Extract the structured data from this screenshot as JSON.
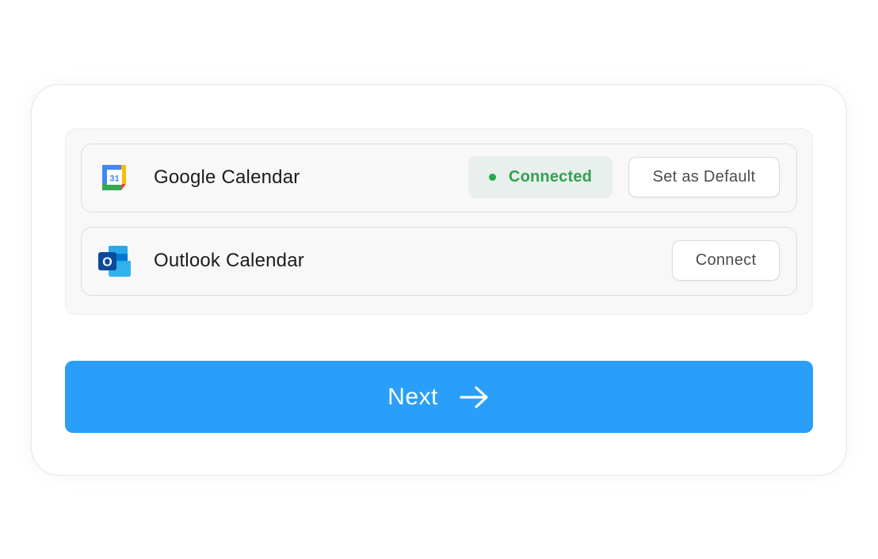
{
  "integrations": [
    {
      "name": "Google Calendar",
      "icon": "google-calendar-icon",
      "icon_date": "31",
      "status": "Connected",
      "action_label": "Set as Default"
    },
    {
      "name": "Outlook Calendar",
      "icon": "outlook-icon",
      "icon_letter": "O",
      "action_label": "Connect"
    }
  ],
  "footer": {
    "next_label": "Next",
    "next_icon": "arrow-right-icon"
  },
  "colors": {
    "primary": "#299ff9",
    "connected": "#31a152",
    "connected_bg": "#e8efec"
  }
}
